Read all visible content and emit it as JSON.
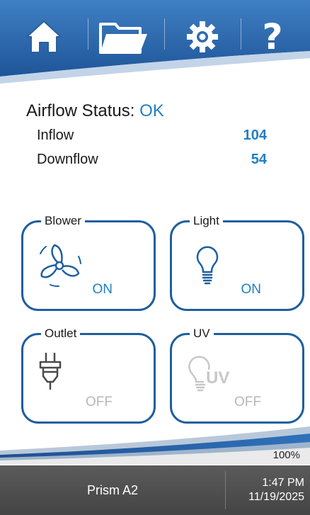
{
  "nav": {
    "home": "home-icon",
    "files": "folder-icon",
    "settings": "gear-icon",
    "help_label": "?"
  },
  "airflow": {
    "label": "Airflow Status: ",
    "status": "OK",
    "inflow_label": "Inflow",
    "inflow_value": "104",
    "downflow_label": "Downflow",
    "downflow_value": "54"
  },
  "controls": {
    "blower": {
      "label": "Blower",
      "state": "ON",
      "icon": "fan-icon"
    },
    "light": {
      "label": "Light",
      "state": "ON",
      "icon": "lightbulb-icon"
    },
    "outlet": {
      "label": "Outlet",
      "state": "OFF",
      "icon": "plug-icon"
    },
    "uv": {
      "label": "UV",
      "state": "OFF",
      "icon": "uv-lamp-icon",
      "icon_text": "UV"
    }
  },
  "footer": {
    "progress": "100%",
    "device_name": "Prism A2",
    "time": "1:47 PM",
    "date": "11/19/2025"
  },
  "colors": {
    "accent": "#1f7fc3",
    "header_blue": "#2a64a8",
    "tile_border": "#1f5f9f",
    "off_text": "#b7b7b7",
    "bottom_bar": "#4d4d4d"
  }
}
